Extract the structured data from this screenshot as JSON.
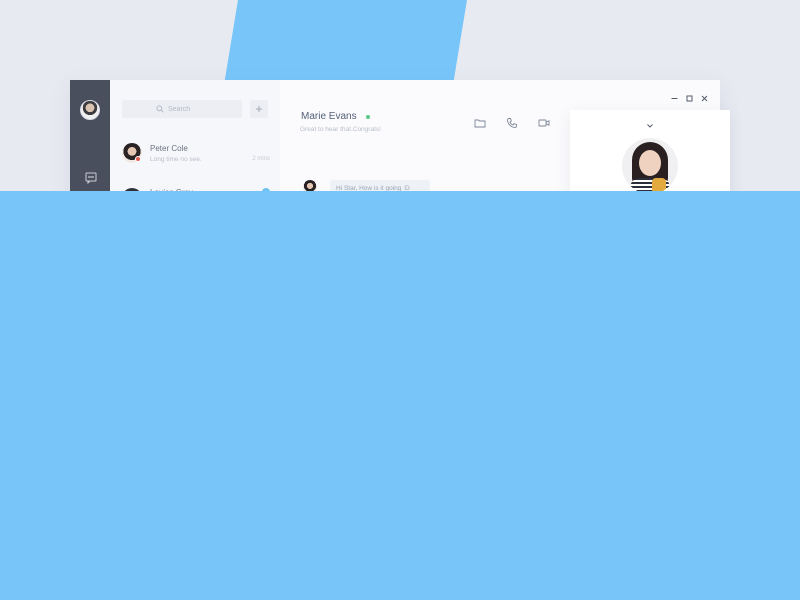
{
  "theme": {
    "backdrop": "#e8eaf2",
    "accent_blue": "#78c6f9",
    "rail": "#4a4f5d",
    "online": "#5cc98a",
    "unread_badge": "#6cc0f4"
  },
  "rail": {
    "avatar_icon": "user-avatar",
    "nav_icon": "chat-bubble-icon"
  },
  "search": {
    "placeholder": "Search",
    "icon": "search-icon"
  },
  "add_button": {
    "label": "+"
  },
  "conversations": [
    {
      "name": "Peter Cole",
      "preview": "Long time no see.",
      "time": "2 mins",
      "badge": ""
    },
    {
      "name": "Louise Gray",
      "preview": "",
      "time": "",
      "badge": ""
    }
  ],
  "chat": {
    "contact_name": "Marie Evans",
    "status": "Great to hear that.Congrats!",
    "tools": [
      "folder-icon",
      "phone-icon",
      "video-camera-icon"
    ],
    "window_controls": [
      "minimize-icon",
      "maximize-icon",
      "close-icon"
    ],
    "messages": [
      {
        "text": "Hi Star, How is it going :D"
      }
    ]
  },
  "profile_card": {
    "collapse_icon": "chevron-down-icon"
  }
}
